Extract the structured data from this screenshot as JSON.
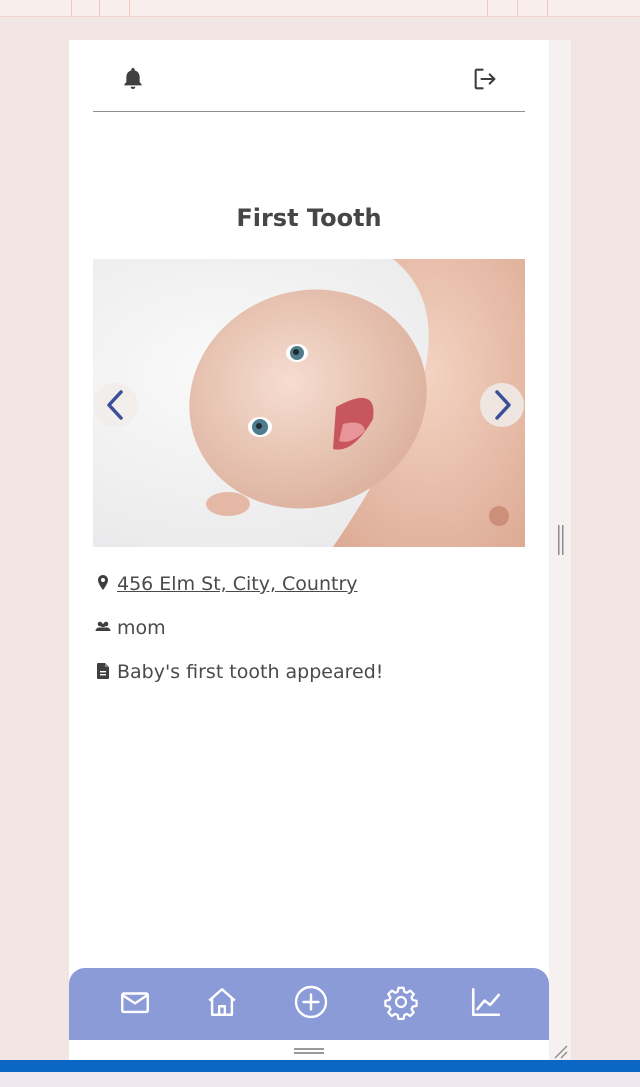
{
  "topbar": {
    "notifications_icon": "bell-icon",
    "logout_icon": "logout-icon"
  },
  "memory": {
    "title": "First Tooth",
    "location": " 456 Elm St, City, Country",
    "person": "mom",
    "description": "Baby's first tooth appeared!"
  },
  "carousel": {
    "prev_icon": "chevron-left-icon",
    "next_icon": "chevron-right-icon"
  },
  "bottom_nav": {
    "items": [
      "mail-icon",
      "home-icon",
      "add-circle-icon",
      "gear-icon",
      "chart-line-icon"
    ]
  },
  "colors": {
    "page_bg": "#f1e6e3",
    "nav_bg": "#8b9bd8",
    "chevron": "#3c4f9a",
    "text": "#4a4a4a"
  }
}
